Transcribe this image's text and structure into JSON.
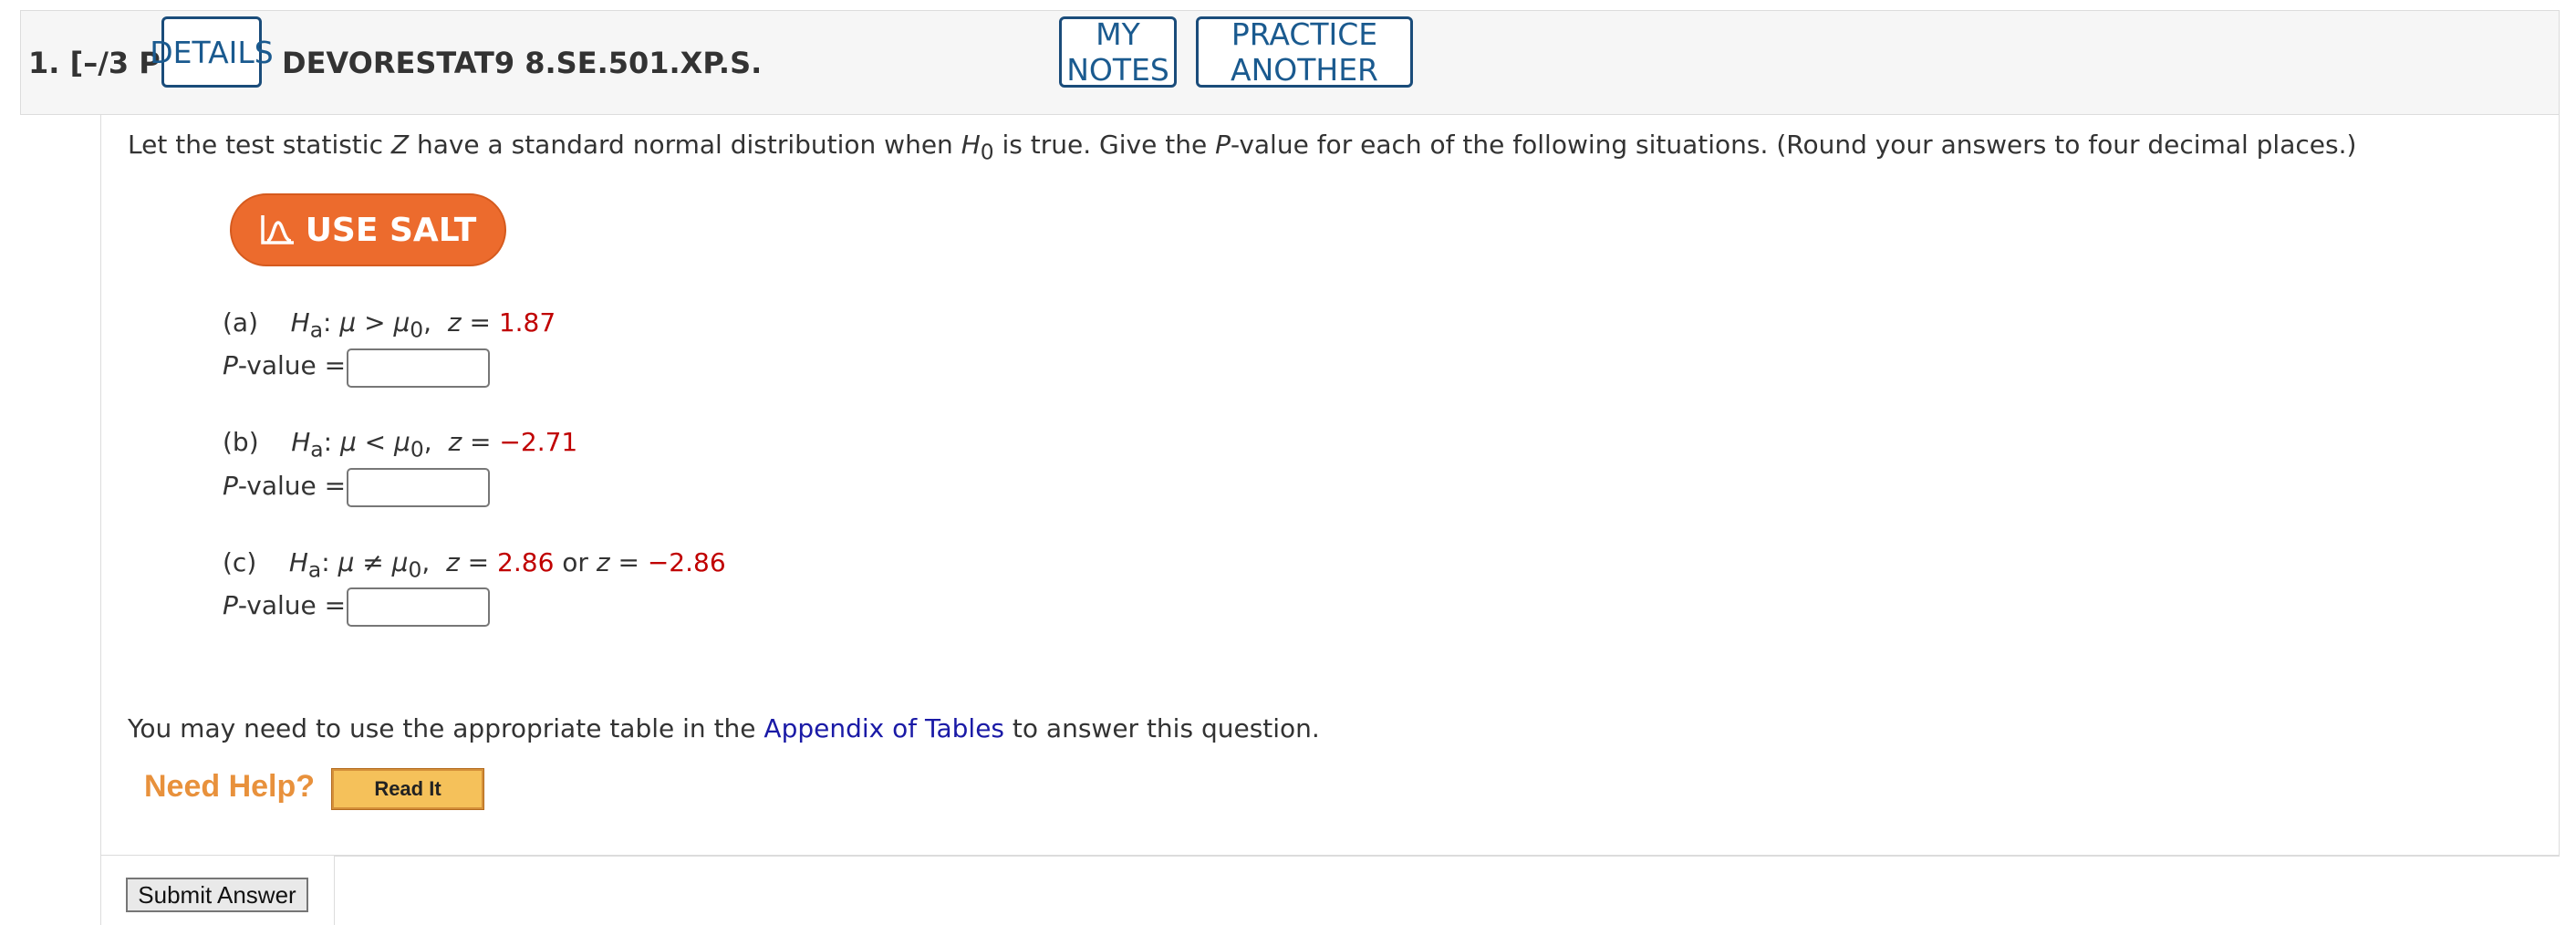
{
  "header": {
    "question_number": "1.",
    "points": "[–/3 Points]",
    "details_label": "DETAILS",
    "question_id": "DEVORESTAT9 8.SE.501.XP.S.",
    "my_notes_label": "MY NOTES",
    "practice_another_label": "PRACTICE ANOTHER"
  },
  "instructions": {
    "t1": "Let the test statistic ",
    "var_z": "Z",
    "t2": " have a standard normal distribution when ",
    "var_h": "H",
    "sub_0": "0",
    "t3": " is true. Give the ",
    "var_p": "P",
    "t4": "-value for each of the following situations. (Round your answers to four decimal places.)"
  },
  "salt_button": {
    "label": "USE SALT",
    "icon": "salt-chart-icon"
  },
  "parts": [
    {
      "letter": "(a)",
      "op": ">",
      "z": "1.87",
      "answer": ""
    },
    {
      "letter": "(b)",
      "op": "<",
      "z": "−2.71",
      "answer": ""
    },
    {
      "letter": "(c)",
      "op": "≠",
      "z": "2.86",
      "or_text": "or",
      "z2": "−2.86",
      "answer": ""
    }
  ],
  "math": {
    "H": "H",
    "a": "a",
    "mu": "μ",
    "zero": "0",
    "z": "z",
    "eq": "=",
    "colon": ":",
    "comma": ","
  },
  "p_label": {
    "p": "P",
    "rest": "-value ="
  },
  "tables_note": {
    "before": "You may need to use the appropriate table in the ",
    "link": "Appendix of Tables",
    "after": " to answer this question."
  },
  "help": {
    "label": "Need Help?",
    "read_it": "Read It"
  },
  "submit_label": "Submit Answer",
  "colors": {
    "accent": "#1a5a8f",
    "salt": "#ec6b2d",
    "value_red": "#c00000",
    "link": "#1a1aa6",
    "help": "#e8913c"
  }
}
